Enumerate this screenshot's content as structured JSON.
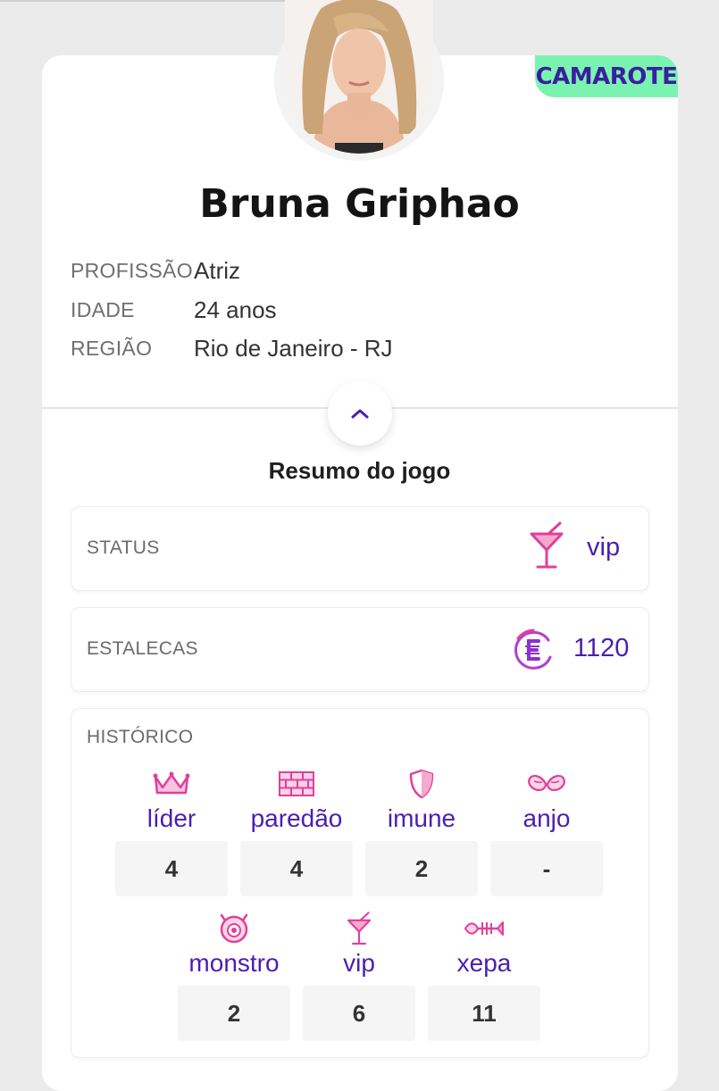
{
  "profile": {
    "badge": "CAMAROTE",
    "name": "Bruna Griphao",
    "fields": [
      {
        "label": "PROFISSÃO",
        "value": "Atriz"
      },
      {
        "label": "IDADE",
        "value": "24 anos"
      },
      {
        "label": "REGIÃO",
        "value": "Rio de Janeiro - RJ"
      }
    ]
  },
  "game": {
    "title": "Resumo do jogo",
    "status": {
      "label": "STATUS",
      "value": "vip",
      "icon": "cocktail-icon"
    },
    "estalecas": {
      "label": "ESTALECAS",
      "value": "1120",
      "icon": "estalecas-coin-icon"
    },
    "historico": {
      "label": "HISTÓRICO",
      "items": [
        {
          "label": "líder",
          "count": "4",
          "icon": "crown-icon"
        },
        {
          "label": "paredão",
          "count": "4",
          "icon": "brick-wall-icon"
        },
        {
          "label": "imune",
          "count": "2",
          "icon": "shield-icon"
        },
        {
          "label": "anjo",
          "count": "-",
          "icon": "angel-wings-icon"
        },
        {
          "label": "monstro",
          "count": "2",
          "icon": "monster-eye-icon"
        },
        {
          "label": "vip",
          "count": "6",
          "icon": "cocktail-icon"
        },
        {
          "label": "xepa",
          "count": "11",
          "icon": "fish-bone-icon"
        }
      ]
    }
  },
  "colors": {
    "accent": "#4a1fb0",
    "badge_bg": "#7bf3b0",
    "icon_pink": "#e0409a"
  }
}
